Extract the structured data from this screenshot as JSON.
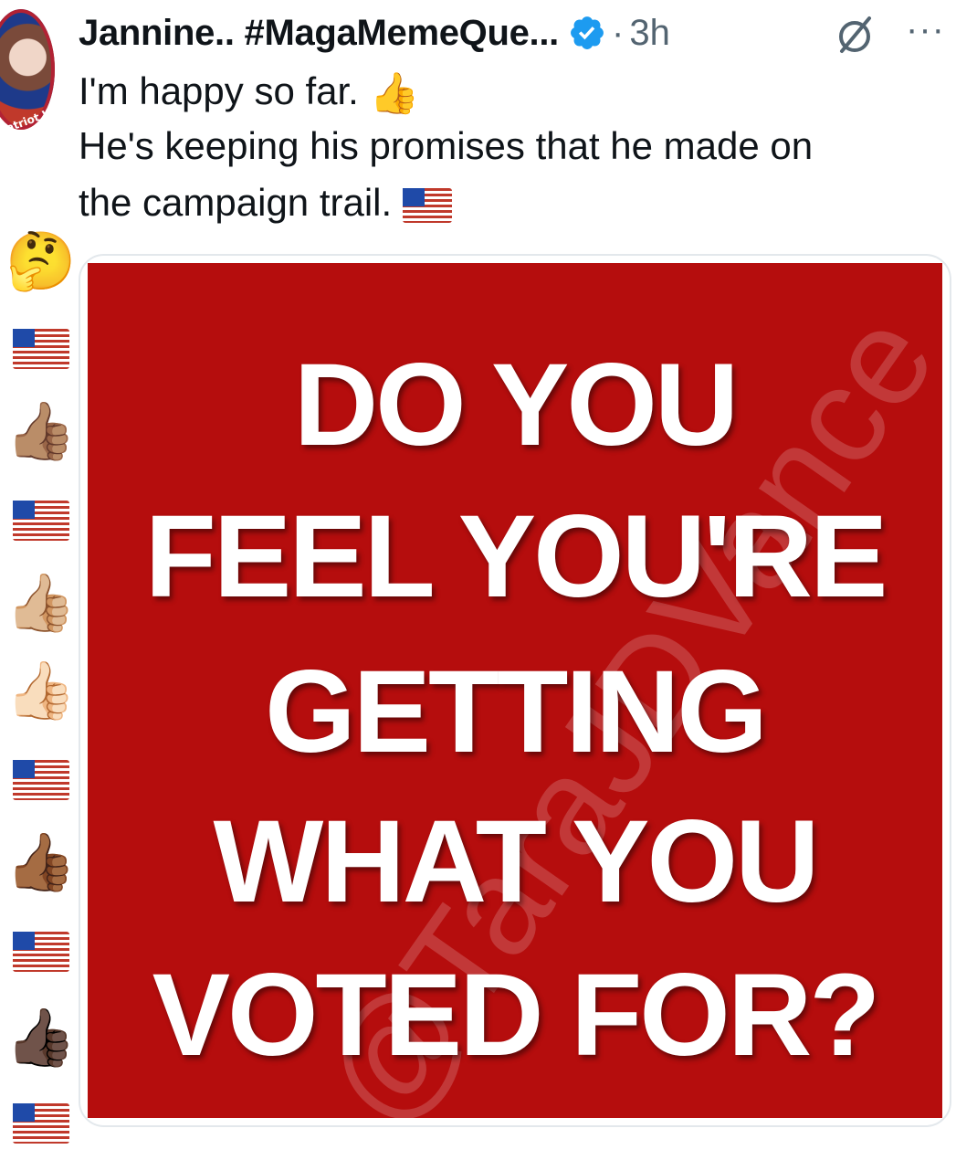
{
  "post": {
    "author_name": "Jannine.. #MagaMemeQue...",
    "separator": "·",
    "time": "3h",
    "more": "···",
    "lines": [
      "I'm happy so far.",
      "He's keeping his promises that he made on",
      "the campaign trail."
    ]
  },
  "avatar": {
    "badge_text": "Patriot Warriors"
  },
  "side_emojis": [
    "🤔",
    "flag",
    "👍🏽",
    "flag",
    "👍🏼",
    "👍🏻",
    "flag",
    "👍🏾",
    "flag",
    "👍🏿",
    "flag"
  ],
  "meme": {
    "lines": [
      "DO YOU",
      "FEEL YOU'RE",
      "GETTING",
      "WHAT YOU",
      "VOTED FOR?"
    ],
    "watermark": "@TaraJDVance"
  },
  "icons": {
    "verified": "verified-badge-icon",
    "grok": "grok-icon",
    "more": "more-options-icon",
    "thumbs_up": "thumbs-up-icon",
    "flag": "us-flag-icon"
  },
  "colors": {
    "verified": "#1d9bf0",
    "meme_bg": "#b50d0d",
    "muted": "#536471"
  }
}
